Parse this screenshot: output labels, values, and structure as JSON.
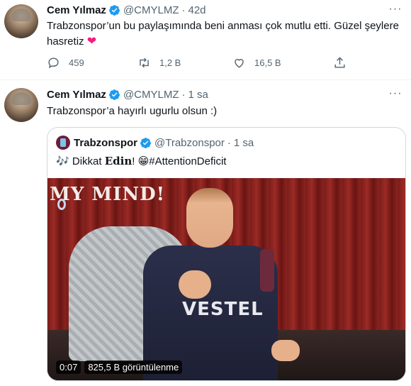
{
  "tweets": [
    {
      "author_name": "Cem Yılmaz",
      "author_handle": "@CMYLMZ",
      "time": "42d",
      "text": "Trabzonspor’un bu paylaşımında beni anması çok mutlu etti. Güzel şeylere hasretiz",
      "emoji": "❤",
      "actions": {
        "reply_count": "459",
        "retweet_count": "1,2 B",
        "like_count": "16,5 B"
      }
    },
    {
      "author_name": "Cem Yılmaz",
      "author_handle": "@CMYLMZ",
      "time": "1 sa",
      "text": "Trabzonspor’a hayırlı ugurlu olsun :)",
      "quoted": {
        "author_name": "Trabzonspor",
        "author_handle": "@Trabzonspor",
        "time": "1 sa",
        "text_music_emoji": "🎶",
        "text_prefix": "Dikkat",
        "text_bold": "Edin",
        "text_after_bold": "!",
        "text_emoji": "😁",
        "text_hashtag": "#AttentionDeficit",
        "video": {
          "overlay_title": "MY MIND!",
          "sponsor_text": "VESTEL",
          "duration": "0:07",
          "views": "825,5 B görüntülenme"
        }
      }
    }
  ],
  "icons": {
    "more": "more-horizontal-icon",
    "verified": "verified-badge-icon",
    "reply": "reply-icon",
    "retweet": "retweet-icon",
    "like": "heart-icon",
    "share": "share-icon"
  },
  "colors": {
    "verified": "#1d9bf0",
    "heart": "#f91880",
    "secondary_text": "#536471",
    "border": "#cfd9de"
  }
}
